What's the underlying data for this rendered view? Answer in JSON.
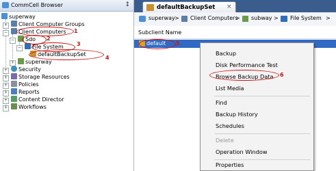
{
  "left_panel": {
    "title": "CommCell Browser",
    "pin_icon": "pin-icon",
    "tree": [
      {
        "label": "superway"
      },
      {
        "label": "Client Computer Groups"
      },
      {
        "label": "Client Computers",
        "annotation": "1"
      },
      {
        "label": "Sdo",
        "annotation": "2"
      },
      {
        "label": "File System",
        "annotation": "3"
      },
      {
        "label": "defaultBackupSet",
        "annotation": "4"
      },
      {
        "label": "superway"
      },
      {
        "label": "Security"
      },
      {
        "label": "Storage Resources"
      },
      {
        "label": "Policies"
      },
      {
        "label": "Reports"
      },
      {
        "label": "Content Director"
      },
      {
        "label": "Workflows"
      }
    ]
  },
  "right_panel": {
    "tab_label": "defaultBackupSet",
    "tab_close": "×",
    "breadcrumb": [
      "superway",
      "Client Computers",
      "subway",
      "File System"
    ],
    "breadcrumb_sep": ">",
    "column_header": "Subclient Name",
    "selected_row": {
      "label": "default",
      "annotation": "5"
    }
  },
  "context_menu": {
    "items": [
      {
        "label": "Backup"
      },
      {
        "label": "Disk Performance Test"
      },
      {
        "label": "Browse Backup Data",
        "annotation": "6"
      },
      {
        "label": "List Media"
      },
      {
        "label": "Find"
      },
      {
        "label": "Backup History"
      },
      {
        "label": "Schedules"
      },
      {
        "label": "Delete",
        "disabled": true
      },
      {
        "label": "Operation Window"
      },
      {
        "label": "Properties"
      }
    ]
  },
  "colors": {
    "annotation_red": "#cc1111",
    "tab_bar": "#3a5d8d",
    "selection": "#316ac5"
  }
}
